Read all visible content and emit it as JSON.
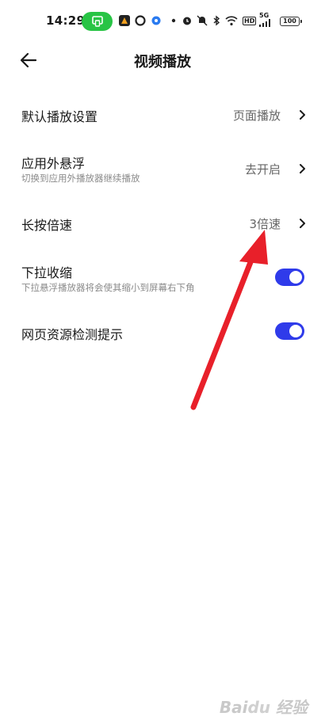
{
  "status_bar": {
    "time": "14:29",
    "signal": "5G",
    "hd": "HD",
    "battery": "100"
  },
  "header": {
    "title": "视频播放"
  },
  "settings": {
    "default_play": {
      "title": "默认播放设置",
      "value": "页面播放"
    },
    "floating": {
      "title": "应用外悬浮",
      "subtitle": "切换到应用外播放器继续播放",
      "value": "去开启"
    },
    "long_press_speed": {
      "title": "长按倍速",
      "value": "3倍速"
    },
    "pull_down_shrink": {
      "title": "下拉收缩",
      "subtitle": "下拉悬浮播放器将会使其缩小到屏幕右下角",
      "enabled": true
    },
    "resource_detect": {
      "title": "网页资源检测提示",
      "enabled": true
    }
  },
  "colors": {
    "toggle_on": "#2f3bea",
    "arrow": "#e8202a",
    "cast_pill": "#28c445"
  }
}
